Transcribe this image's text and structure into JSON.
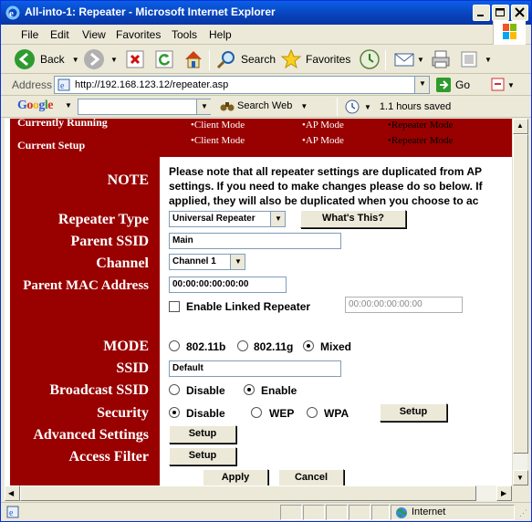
{
  "window": {
    "title": "All-into-1: Repeater - Microsoft Internet Explorer"
  },
  "menu": [
    "File",
    "Edit",
    "View",
    "Favorites",
    "Tools",
    "Help"
  ],
  "toolbar": {
    "back": "Back",
    "search": "Search",
    "favorites": "Favorites"
  },
  "address": {
    "label": "Address",
    "url": "http://192.168.123.12/repeater.asp",
    "go": "Go"
  },
  "google": {
    "logo": "Google",
    "search_web": "Search Web",
    "saved": "1.1 hours saved"
  },
  "page": {
    "currently_running_label": "Currently Running",
    "current_setup_label": "Current Setup",
    "modes_running": [
      "Client Mode",
      "AP Mode",
      "Repeater Mode"
    ],
    "modes_setup": [
      "Client Mode",
      "AP Mode",
      "Repeater Mode"
    ],
    "note_label": "NOTE",
    "note_lines": [
      "Please note that all repeater settings are duplicated from AP",
      "settings. If you need to make changes please do so below. If",
      "applied, they will also be duplicated when you choose to ac"
    ],
    "repeater_type_label": "Repeater Type",
    "repeater_type_value": "Universal Repeater",
    "whats_this": "What's This?",
    "parent_ssid_label": "Parent SSID",
    "parent_ssid_value": "Main",
    "channel_label": "Channel",
    "channel_value": "Channel 1",
    "parent_mac_label": "Parent MAC Address",
    "parent_mac_value": "00:00:00:00:00:00",
    "linked_repeater_label": "Enable Linked Repeater",
    "linked_mac_value": "00:00:00:00:00:00",
    "mode_label": "MODE",
    "mode_options": [
      "802.11b",
      "802.11g",
      "Mixed"
    ],
    "ssid_label": "SSID",
    "ssid_value": "Default",
    "broadcast_label": "Broadcast SSID",
    "broadcast_options": [
      "Disable",
      "Enable"
    ],
    "security_label": "Security",
    "security_options": [
      "Disable",
      "WEP",
      "WPA"
    ],
    "setup_btn": "Setup",
    "advanced_label": "Advanced Settings",
    "access_label": "Access Filter",
    "apply_btn": "Apply",
    "cancel_btn": "Cancel"
  },
  "status": {
    "zone": "Internet"
  }
}
